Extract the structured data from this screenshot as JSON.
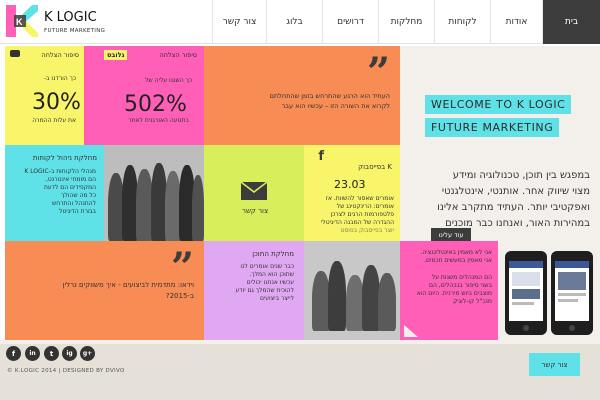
{
  "colors": {
    "cyan": "#5fe1e8",
    "orange": "#f78c55",
    "yellow": "#f9f56a",
    "pink": "#ff5fb6",
    "purple": "#e0a8f2",
    "green": "#d9ee5b",
    "dark": "#3d3c3c",
    "cream": "#f3efea",
    "footer_bg": "#e6e1d8"
  },
  "header": {
    "logo_title": "K LOGIC",
    "logo_subtitle": "FUTURE MARKETING",
    "nav": [
      {
        "label": "בית",
        "active": true
      },
      {
        "label": "אודות",
        "active": false
      },
      {
        "label": "לקוחות",
        "active": false
      },
      {
        "label": "מחלקות",
        "active": false
      },
      {
        "label": "דרושים",
        "active": false
      },
      {
        "label": "בלוג",
        "active": false
      },
      {
        "label": "צור קשר",
        "active": false
      }
    ]
  },
  "tiles": {
    "stat1": {
      "tag": "סיפור הצלחה",
      "top_text": "כך הורדנו ב-",
      "percent": "30%",
      "bottom_text": "את עלות ההמרה"
    },
    "stat2": {
      "tag": "סיפור הצלחה",
      "logo_text": "גלובס",
      "top_text": "כך השגנו עליה של",
      "percent": "502%",
      "bottom_text": "בתנועה האורגנית לאתר"
    },
    "quote1": {
      "text_lines": [
        "העתיד הוא הרגע שהתרחש בזמן שהתחלתם",
        "לקרוא את השורה הזו – עכשיו הוא עבר"
      ]
    },
    "clients": {
      "title": "מחלקת ניהול לקוחות",
      "lines": [
        "מנהלי הלקוחות ב-K LOGIC",
        "הם מומחי אינטרנט,",
        "המקפידים הם לדעת",
        "כל מה שהולך",
        "להתנהל והתרחש",
        "בגזרת הדיגיטל"
      ]
    },
    "contact": {
      "label": "צור קשר"
    },
    "facebook": {
      "title": "K בפייסבוק",
      "date": "23.03",
      "lines": [
        "אומרים שאסור להשוות. אז",
        "אומרים: הרינקטינג של",
        "פלטפורמות הרגים לצרכן",
        "ההגדרה של המבנה הדיגיטלי",
        "יוצר בפייסבוק בפוסט"
      ]
    },
    "hero": {
      "welcome": "WELCOME TO K LOGIC",
      "tagline": "FUTURE MARKETING",
      "body_lines": [
        "במפגש בין תוכן, טכנולוגיה ומידע",
        "מצוי שיווק אחר. אותנטי, אינטלגנטי",
        "ואפקטיבי יותר. העתיד מתקרב אלינו",
        "במהירות האור, ואנחנו כבר מוכנים"
      ],
      "more_button": "עוד עלינו"
    },
    "quote2": {
      "text_lines": [
        "וידאו: מתדמית לביצועים - איך משווקים נרלין",
        "ב-2015?"
      ]
    },
    "content_dept": {
      "title": "מחלקת התוכן",
      "lines": [
        "כבר שנים אומרים לנו",
        "שתוכן הוא המלך.",
        "עכשיו אנחנו יכולים",
        "להוכיח שהמלך גם יודע",
        "לייצר ביצועים"
      ]
    },
    "ai": {
      "lines": [
        "אני לא מאמין באינטליגנציה.",
        "אני מאמין במעשים חכמים.",
        "",
        "הם המנהלים משנות על",
        "בשני סיפור בנבהלים, הם",
        "מוצבים ביוש מירנית. היום הוא",
        "מנכ\"ל קו-לוגיק"
      ]
    }
  },
  "footer": {
    "social": [
      "f",
      "in",
      "t",
      "ig",
      "g+"
    ],
    "copyright": "© K.LOGIC 2014 | DESIGNED BY DVIVO",
    "contact_button": "צור קשר"
  }
}
